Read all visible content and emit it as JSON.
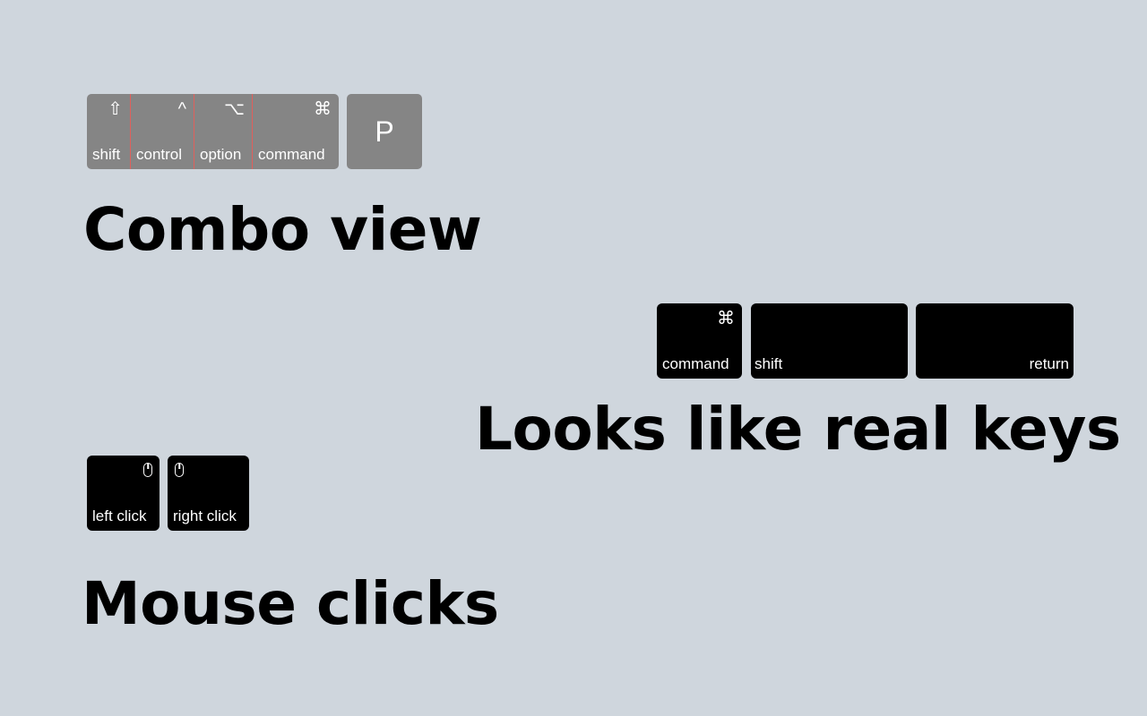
{
  "combo": {
    "heading": "Combo view",
    "modifier_keys": [
      {
        "symbol": "⇧",
        "label": "shift"
      },
      {
        "symbol": "^",
        "label": "control"
      },
      {
        "symbol": "⌥",
        "label": "option"
      },
      {
        "symbol": "⌘",
        "label": "command"
      }
    ],
    "main_key": "P",
    "key_color": "#858585",
    "divider_color": "#e0605c"
  },
  "real_keys": {
    "heading": "Looks like real keys",
    "keys": [
      {
        "symbol": "⌘",
        "label": "command"
      },
      {
        "symbol": "",
        "label": "shift"
      },
      {
        "symbol": "",
        "label": "return"
      }
    ],
    "key_color": "#000000"
  },
  "mouse": {
    "heading": "Mouse clicks",
    "keys": [
      {
        "icon": "mouse-icon",
        "label": "left click"
      },
      {
        "icon": "mouse-icon",
        "label": "right click"
      }
    ]
  },
  "background_color": "#cfd6dd"
}
